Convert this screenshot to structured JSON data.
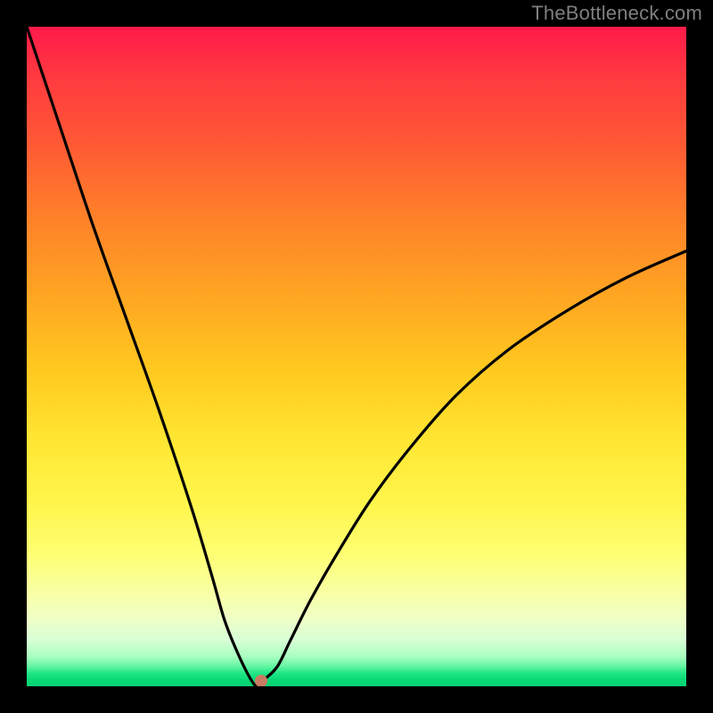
{
  "watermark": "TheBottleneck.com",
  "chart_data": {
    "type": "line",
    "title": "",
    "xlabel": "",
    "ylabel": "",
    "xlim": [
      0,
      100
    ],
    "ylim": [
      0,
      100
    ],
    "series": [
      {
        "name": "curve",
        "x": [
          0,
          5,
          10,
          15,
          20,
          25,
          28,
          30,
          32,
          34,
          35,
          36,
          38,
          40,
          43,
          47,
          52,
          58,
          65,
          73,
          82,
          91,
          100
        ],
        "values": [
          100,
          85,
          70,
          56,
          42,
          27,
          17,
          10,
          5,
          1,
          0,
          1,
          3,
          7,
          13,
          20,
          28,
          36,
          44,
          51,
          57,
          62,
          66
        ]
      }
    ],
    "marker": {
      "x": 35.5,
      "y": 0.8
    },
    "background": {
      "type": "vertical-gradient",
      "stops": [
        {
          "pct": 0,
          "color": "#ff1a4a"
        },
        {
          "pct": 50,
          "color": "#ffcc22"
        },
        {
          "pct": 80,
          "color": "#feff73"
        },
        {
          "pct": 100,
          "color": "#06d474"
        }
      ]
    }
  },
  "dot_color": "#c97b63"
}
